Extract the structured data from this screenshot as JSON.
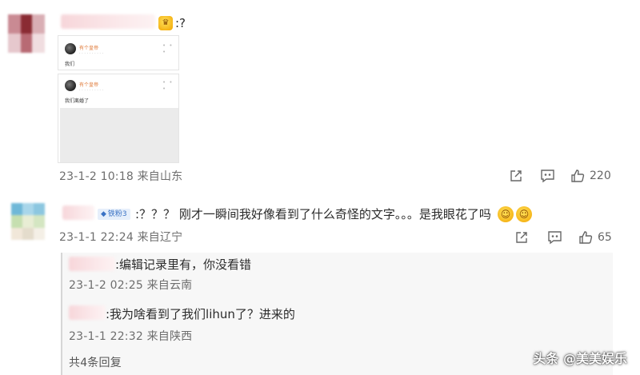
{
  "comment1": {
    "suffix": ":?",
    "timestamp": "23-1-2 10:18 来自山东",
    "like_count": "220",
    "embedded": {
      "post1": {
        "username": "有个皇帝",
        "text": "我们"
      },
      "post2": {
        "username": "有个皇帝",
        "text": "我们离婚了"
      }
    }
  },
  "comment2": {
    "badge": "铁粉3",
    "text": ":？？？ 刚才一瞬间我好像看到了什么奇怪的文字。。。是我眼花了吗",
    "timestamp": "23-1-1 22:24 来自辽宁",
    "like_count": "65"
  },
  "replies": [
    {
      "text": ":编辑记录里有，你没看错",
      "timestamp": "23-1-2 02:25 来自云南"
    },
    {
      "text": ":我为啥看到了我们lihun了？进来的",
      "timestamp": "23-1-1 22:32 来自陕西"
    }
  ],
  "replies_more": "共4条回复",
  "watermark": "头条 @美美娱乐",
  "icons": [
    "share-icon",
    "comment-icon",
    "like-icon"
  ],
  "colors": {
    "meta_text": "#6e6e6e",
    "badge_bg": "#e6effb",
    "badge_text": "#3a72c4"
  }
}
